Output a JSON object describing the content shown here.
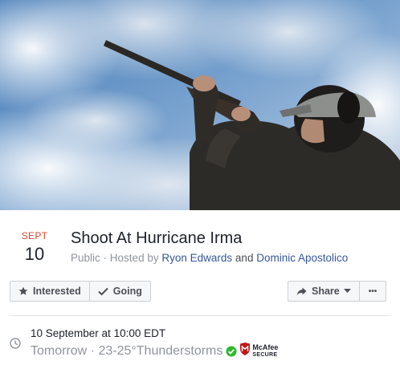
{
  "event": {
    "month": "SEPT",
    "day": "10",
    "title": "Shoot At Hurricane Irma",
    "privacy": "Public",
    "hosted_by_prefix": "Hosted by",
    "host1": "Ryon Edwards",
    "and": "and",
    "host2": "Dominic Apostolico"
  },
  "actions": {
    "interested_label": "Interested",
    "going_label": "Going",
    "share_label": "Share",
    "more_label": "•••"
  },
  "when": {
    "date_text": "10 September at 10:00 EDT",
    "relative": "Tomorrow",
    "weather": "23-25°Thunderstorms"
  },
  "badge": {
    "brand": "McAfee",
    "secure": "SECURE"
  },
  "colors": {
    "month_red": "#e0452f",
    "link_blue": "#365899",
    "check_green": "#2eb82e",
    "mcafee_red": "#c01818"
  },
  "icons": [
    "star-icon",
    "checkmark-icon",
    "share-arrow-icon",
    "caret-down-icon",
    "clock-icon",
    "verified-check-icon",
    "mcafee-shield-icon"
  ]
}
